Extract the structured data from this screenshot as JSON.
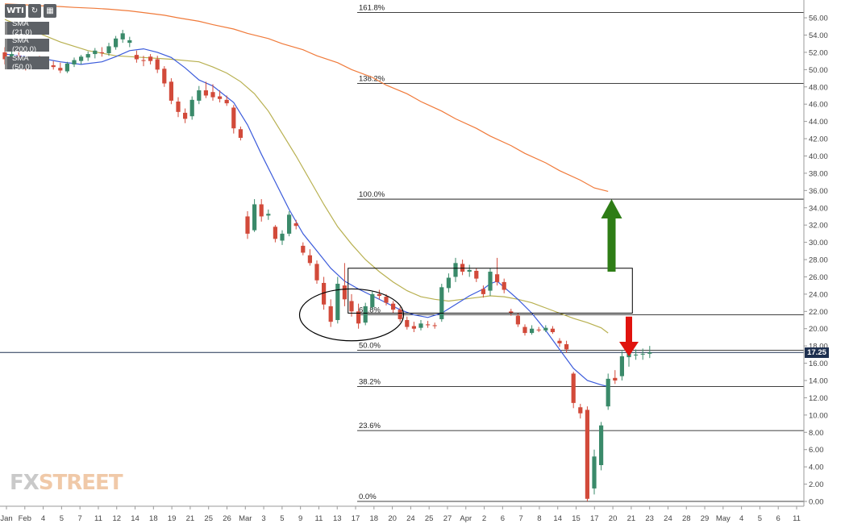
{
  "toolbar": {
    "symbol": "WTI"
  },
  "indicators": [
    {
      "label": "SMA (21,0)",
      "color": "#3b5bdb"
    },
    {
      "label": "SMA (200,0)",
      "color": "#f07a3a"
    },
    {
      "label": "SMA (50,0)",
      "color": "#b8b050"
    }
  ],
  "watermark": {
    "part1": "FX",
    "part2": "STREET"
  },
  "chart_data": {
    "type": "candlestick",
    "instrument": "WTI",
    "ylim": [
      0,
      57.5
    ],
    "y_ticks": [
      "56.00",
      "54.00",
      "52.00",
      "50.00",
      "48.00",
      "46.00",
      "44.00",
      "42.00",
      "40.00",
      "38.00",
      "36.00",
      "34.00",
      "32.00",
      "30.00",
      "28.00",
      "26.00",
      "24.00",
      "22.00",
      "20.00",
      "18.00",
      "16.00",
      "14.00",
      "12.00",
      "10.00",
      "8.00",
      "6.00",
      "4.00",
      "2.00",
      "0.00"
    ],
    "x_labels": [
      "Jan",
      "Feb",
      "4",
      "5",
      "7",
      "11",
      "12",
      "14",
      "18",
      "19",
      "21",
      "25",
      "26",
      "Mar",
      "3",
      "5",
      "9",
      "11",
      "13",
      "17",
      "18",
      "20",
      "24",
      "25",
      "27",
      "Apr",
      "2",
      "6",
      "7",
      "8",
      "14",
      "15",
      "17",
      "20",
      "21",
      "23",
      "24",
      "28",
      "29",
      "May",
      "4",
      "5",
      "6",
      "11"
    ],
    "last_price": "17.25",
    "last_price_value": 17.25,
    "fibonacci": [
      {
        "label": "161.8%",
        "value": 56.6
      },
      {
        "label": "138.2%",
        "value": 48.4
      },
      {
        "label": "100.0%",
        "value": 35.0
      },
      {
        "label": "61.8%",
        "value": 21.6
      },
      {
        "label": "50.0%",
        "value": 17.5
      },
      {
        "label": "38.2%",
        "value": 13.3
      },
      {
        "label": "23.6%",
        "value": 8.2
      },
      {
        "label": "0.0%",
        "value": 0.0
      }
    ],
    "fib_line_end": 30,
    "candles": [
      {
        "o": 52.0,
        "h": 52.6,
        "l": 50.6,
        "c": 51.2
      },
      {
        "o": 51.3,
        "h": 52.2,
        "l": 50.7,
        "c": 51.8
      },
      {
        "o": 51.6,
        "h": 52.0,
        "l": 50.3,
        "c": 50.8
      },
      {
        "o": 50.7,
        "h": 51.3,
        "l": 49.9,
        "c": 50.3
      },
      {
        "o": 50.4,
        "h": 51.4,
        "l": 50.1,
        "c": 51.2
      },
      {
        "o": 51.1,
        "h": 51.6,
        "l": 50.5,
        "c": 50.8
      },
      {
        "o": 50.9,
        "h": 51.3,
        "l": 50.3,
        "c": 50.6
      },
      {
        "o": 50.5,
        "h": 51.0,
        "l": 50.0,
        "c": 50.3
      },
      {
        "o": 50.2,
        "h": 50.8,
        "l": 49.6,
        "c": 49.9
      },
      {
        "o": 49.8,
        "h": 50.9,
        "l": 49.6,
        "c": 50.7
      },
      {
        "o": 50.6,
        "h": 51.4,
        "l": 50.3,
        "c": 51.1
      },
      {
        "o": 51.0,
        "h": 51.7,
        "l": 50.6,
        "c": 51.5
      },
      {
        "o": 51.4,
        "h": 52.1,
        "l": 51.0,
        "c": 51.8
      },
      {
        "o": 51.8,
        "h": 52.5,
        "l": 51.3,
        "c": 52.2
      },
      {
        "o": 52.0,
        "h": 52.6,
        "l": 51.5,
        "c": 51.9
      },
      {
        "o": 51.9,
        "h": 53.1,
        "l": 51.6,
        "c": 52.7
      },
      {
        "o": 52.6,
        "h": 53.9,
        "l": 52.3,
        "c": 53.6
      },
      {
        "o": 53.5,
        "h": 54.6,
        "l": 53.1,
        "c": 54.2
      },
      {
        "o": 53.1,
        "h": 53.8,
        "l": 52.6,
        "c": 53.4
      },
      {
        "o": 51.7,
        "h": 52.2,
        "l": 50.8,
        "c": 51.2
      },
      {
        "o": 51.1,
        "h": 51.6,
        "l": 50.4,
        "c": 51.0
      },
      {
        "o": 51.5,
        "h": 51.8,
        "l": 50.6,
        "c": 51.0
      },
      {
        "o": 51.2,
        "h": 51.6,
        "l": 49.6,
        "c": 50.0
      },
      {
        "o": 50.1,
        "h": 50.4,
        "l": 48.0,
        "c": 48.4
      },
      {
        "o": 48.6,
        "h": 49.0,
        "l": 46.0,
        "c": 46.4
      },
      {
        "o": 46.3,
        "h": 46.8,
        "l": 44.5,
        "c": 45.1
      },
      {
        "o": 45.0,
        "h": 45.5,
        "l": 43.8,
        "c": 44.3
      },
      {
        "o": 44.6,
        "h": 46.9,
        "l": 44.2,
        "c": 46.5
      },
      {
        "o": 46.4,
        "h": 48.1,
        "l": 46.0,
        "c": 47.6
      },
      {
        "o": 47.6,
        "h": 48.6,
        "l": 46.7,
        "c": 47.0
      },
      {
        "o": 47.4,
        "h": 48.3,
        "l": 46.4,
        "c": 46.8
      },
      {
        "o": 46.9,
        "h": 47.6,
        "l": 46.2,
        "c": 46.6
      },
      {
        "o": 46.5,
        "h": 47.0,
        "l": 45.8,
        "c": 46.1
      },
      {
        "o": 45.6,
        "h": 45.9,
        "l": 42.6,
        "c": 43.2
      },
      {
        "o": 43.1,
        "h": 43.4,
        "l": 41.8,
        "c": 42.1
      },
      {
        "o": 33.0,
        "h": 33.6,
        "l": 30.4,
        "c": 31.0
      },
      {
        "o": 31.4,
        "h": 35.0,
        "l": 31.2,
        "c": 34.4
      },
      {
        "o": 34.4,
        "h": 35.0,
        "l": 32.4,
        "c": 33.0
      },
      {
        "o": 33.1,
        "h": 33.8,
        "l": 32.6,
        "c": 33.3
      },
      {
        "o": 31.8,
        "h": 32.0,
        "l": 30.0,
        "c": 30.4
      },
      {
        "o": 30.2,
        "h": 31.4,
        "l": 29.7,
        "c": 31.0
      },
      {
        "o": 31.0,
        "h": 33.6,
        "l": 30.7,
        "c": 33.2
      },
      {
        "o": 32.2,
        "h": 32.6,
        "l": 31.5,
        "c": 31.9
      },
      {
        "o": 29.6,
        "h": 30.0,
        "l": 28.5,
        "c": 28.8
      },
      {
        "o": 28.5,
        "h": 29.2,
        "l": 27.3,
        "c": 27.6
      },
      {
        "o": 27.5,
        "h": 27.9,
        "l": 25.2,
        "c": 25.6
      },
      {
        "o": 25.3,
        "h": 26.0,
        "l": 22.2,
        "c": 22.8
      },
      {
        "o": 22.6,
        "h": 23.4,
        "l": 20.2,
        "c": 20.8
      },
      {
        "o": 21.0,
        "h": 26.0,
        "l": 20.6,
        "c": 25.2
      },
      {
        "o": 25.0,
        "h": 27.6,
        "l": 22.6,
        "c": 23.4
      },
      {
        "o": 23.2,
        "h": 24.0,
        "l": 21.4,
        "c": 22.0
      },
      {
        "o": 22.0,
        "h": 22.9,
        "l": 20.0,
        "c": 20.6
      },
      {
        "o": 20.7,
        "h": 23.0,
        "l": 20.4,
        "c": 22.6
      },
      {
        "o": 22.5,
        "h": 24.4,
        "l": 22.2,
        "c": 24.0
      },
      {
        "o": 24.0,
        "h": 24.5,
        "l": 23.4,
        "c": 23.8
      },
      {
        "o": 23.7,
        "h": 24.0,
        "l": 22.7,
        "c": 23.0
      },
      {
        "o": 22.9,
        "h": 23.2,
        "l": 21.8,
        "c": 22.2
      },
      {
        "o": 22.2,
        "h": 22.5,
        "l": 20.8,
        "c": 21.1
      },
      {
        "o": 21.0,
        "h": 21.4,
        "l": 19.9,
        "c": 20.2
      },
      {
        "o": 20.3,
        "h": 20.8,
        "l": 19.6,
        "c": 20.0
      },
      {
        "o": 20.1,
        "h": 21.0,
        "l": 19.8,
        "c": 20.6
      },
      {
        "o": 20.5,
        "h": 20.9,
        "l": 20.1,
        "c": 20.4
      },
      {
        "o": 20.4,
        "h": 20.7,
        "l": 20.0,
        "c": 20.3
      },
      {
        "o": 21.1,
        "h": 25.2,
        "l": 20.8,
        "c": 24.8
      },
      {
        "o": 24.7,
        "h": 26.4,
        "l": 24.2,
        "c": 25.9
      },
      {
        "o": 26.0,
        "h": 28.2,
        "l": 25.4,
        "c": 27.6
      },
      {
        "o": 27.5,
        "h": 28.0,
        "l": 26.2,
        "c": 26.6
      },
      {
        "o": 26.6,
        "h": 27.4,
        "l": 26.0,
        "c": 26.8
      },
      {
        "o": 26.7,
        "h": 27.0,
        "l": 25.4,
        "c": 25.8
      },
      {
        "o": 24.6,
        "h": 25.0,
        "l": 23.6,
        "c": 24.0
      },
      {
        "o": 24.4,
        "h": 27.0,
        "l": 23.8,
        "c": 26.6
      },
      {
        "o": 26.3,
        "h": 28.2,
        "l": 25.0,
        "c": 25.4
      },
      {
        "o": 25.4,
        "h": 25.8,
        "l": 24.1,
        "c": 24.5
      },
      {
        "o": 22.0,
        "h": 22.3,
        "l": 21.5,
        "c": 21.8
      },
      {
        "o": 21.5,
        "h": 21.8,
        "l": 20.2,
        "c": 20.5
      },
      {
        "o": 20.2,
        "h": 20.5,
        "l": 19.2,
        "c": 19.5
      },
      {
        "o": 19.5,
        "h": 20.4,
        "l": 19.3,
        "c": 20.0
      },
      {
        "o": 19.9,
        "h": 20.2,
        "l": 19.6,
        "c": 19.8
      },
      {
        "o": 19.8,
        "h": 20.4,
        "l": 19.6,
        "c": 20.1
      },
      {
        "o": 20.0,
        "h": 20.3,
        "l": 19.4,
        "c": 19.6
      },
      {
        "o": 18.6,
        "h": 18.9,
        "l": 17.9,
        "c": 18.3
      },
      {
        "o": 18.2,
        "h": 18.6,
        "l": 17.2,
        "c": 17.6
      },
      {
        "o": 14.8,
        "h": 15.0,
        "l": 10.8,
        "c": 11.4
      },
      {
        "o": 10.9,
        "h": 11.3,
        "l": 9.6,
        "c": 10.2
      },
      {
        "o": 10.6,
        "h": 11.0,
        "l": 0.0,
        "c": 0.3
      },
      {
        "o": 1.5,
        "h": 6.0,
        "l": 0.8,
        "c": 5.2
      },
      {
        "o": 4.2,
        "h": 9.2,
        "l": 3.6,
        "c": 8.8
      },
      {
        "o": 11.0,
        "h": 14.8,
        "l": 10.6,
        "c": 14.2
      },
      {
        "o": 14.3,
        "h": 15.2,
        "l": 13.6,
        "c": 14.0
      },
      {
        "o": 14.5,
        "h": 17.4,
        "l": 14.0,
        "c": 16.8
      },
      {
        "o": 16.7,
        "h": 18.4,
        "l": 15.6,
        "c": 18.0
      },
      {
        "o": 16.9,
        "h": 17.6,
        "l": 16.4,
        "c": 17.0
      },
      {
        "o": 17.0,
        "h": 17.7,
        "l": 16.4,
        "c": 17.1
      },
      {
        "o": 17.1,
        "h": 18.0,
        "l": 16.6,
        "c": 17.25
      }
    ],
    "sma_200": [
      [
        0,
        57.6
      ],
      [
        3,
        57.5
      ],
      [
        5,
        57.4
      ],
      [
        8,
        57.3
      ],
      [
        10,
        57.2
      ],
      [
        13,
        57.1
      ],
      [
        15,
        57.0
      ],
      [
        18,
        56.8
      ],
      [
        20,
        56.6
      ],
      [
        23,
        56.3
      ],
      [
        25,
        56.0
      ],
      [
        28,
        55.6
      ],
      [
        30,
        55.2
      ],
      [
        33,
        54.7
      ],
      [
        35,
        54.2
      ],
      [
        38,
        53.6
      ],
      [
        40,
        53.0
      ],
      [
        43,
        52.3
      ],
      [
        45,
        51.6
      ],
      [
        48,
        50.8
      ],
      [
        50,
        50.0
      ],
      [
        53,
        49.1
      ],
      [
        55,
        48.2
      ],
      [
        58,
        47.2
      ],
      [
        60,
        46.3
      ],
      [
        63,
        45.2
      ],
      [
        65,
        44.3
      ],
      [
        68,
        43.2
      ],
      [
        70,
        42.3
      ],
      [
        73,
        41.2
      ],
      [
        75,
        40.3
      ],
      [
        78,
        39.2
      ],
      [
        80,
        38.3
      ],
      [
        83,
        37.2
      ],
      [
        85,
        36.3
      ],
      [
        87,
        35.9
      ]
    ],
    "sma_50": [
      [
        0,
        55.8
      ],
      [
        4,
        54.5
      ],
      [
        8,
        53.2
      ],
      [
        12,
        52.2
      ],
      [
        16,
        51.6
      ],
      [
        20,
        51.4
      ],
      [
        24,
        51.2
      ],
      [
        28,
        50.9
      ],
      [
        30,
        50.3
      ],
      [
        32,
        49.6
      ],
      [
        34,
        48.6
      ],
      [
        36,
        47.2
      ],
      [
        38,
        45.2
      ],
      [
        40,
        42.6
      ],
      [
        42,
        40.0
      ],
      [
        44,
        37.2
      ],
      [
        46,
        34.4
      ],
      [
        48,
        31.8
      ],
      [
        50,
        29.8
      ],
      [
        52,
        28.0
      ],
      [
        54,
        26.6
      ],
      [
        56,
        25.4
      ],
      [
        58,
        24.4
      ],
      [
        60,
        23.7
      ],
      [
        62,
        23.4
      ],
      [
        64,
        23.2
      ],
      [
        66,
        23.4
      ],
      [
        68,
        23.6
      ],
      [
        70,
        23.8
      ],
      [
        72,
        23.7
      ],
      [
        74,
        23.4
      ],
      [
        76,
        23.0
      ],
      [
        78,
        22.4
      ],
      [
        80,
        21.8
      ],
      [
        82,
        21.2
      ],
      [
        84,
        20.7
      ],
      [
        86,
        20.1
      ],
      [
        87,
        19.5
      ]
    ],
    "sma_21": [
      [
        0,
        51.8
      ],
      [
        3,
        51.5
      ],
      [
        6,
        51.2
      ],
      [
        8,
        50.9
      ],
      [
        11,
        50.6
      ],
      [
        14,
        50.9
      ],
      [
        16,
        51.5
      ],
      [
        18,
        52.2
      ],
      [
        20,
        52.4
      ],
      [
        22,
        52.0
      ],
      [
        24,
        51.4
      ],
      [
        26,
        50.2
      ],
      [
        28,
        48.8
      ],
      [
        30,
        48.1
      ],
      [
        33,
        46.2
      ],
      [
        35,
        43.6
      ],
      [
        37,
        40.2
      ],
      [
        39,
        37.0
      ],
      [
        41,
        33.8
      ],
      [
        43,
        31.0
      ],
      [
        45,
        29.0
      ],
      [
        47,
        27.0
      ],
      [
        49,
        25.5
      ],
      [
        51,
        24.6
      ],
      [
        53,
        23.8
      ],
      [
        55,
        23.0
      ],
      [
        57,
        22.2
      ],
      [
        59,
        21.6
      ],
      [
        61,
        21.3
      ],
      [
        63,
        21.8
      ],
      [
        65,
        22.8
      ],
      [
        67,
        23.8
      ],
      [
        69,
        24.6
      ],
      [
        70,
        25.2
      ],
      [
        71,
        25.5
      ],
      [
        72,
        24.8
      ],
      [
        74,
        23.4
      ],
      [
        76,
        21.8
      ],
      [
        78,
        19.8
      ],
      [
        80,
        17.6
      ],
      [
        82,
        15.4
      ],
      [
        84,
        14.0
      ],
      [
        86,
        13.5
      ],
      [
        87,
        13.3
      ]
    ],
    "annotations": {
      "rectangle": {
        "x0": 49.5,
        "x1": 90.5,
        "y0": 21.8,
        "y1": 27.0
      },
      "ellipse": {
        "cx": 50,
        "cy": 21.6,
        "rx_bars": 6,
        "ry_value": 3.0
      },
      "up_arrow": {
        "bar": 87.5,
        "from": 26.6,
        "to": 35.0,
        "color": "#2e7d16"
      },
      "down_arrow": {
        "bar": 90.0,
        "from": 21.4,
        "to": 16.8,
        "color": "#e0130e"
      }
    }
  }
}
